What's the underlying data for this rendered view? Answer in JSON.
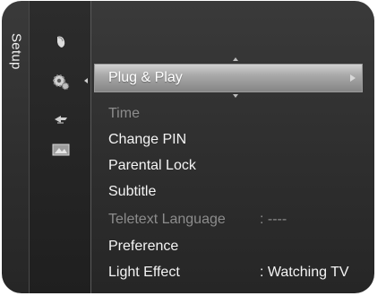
{
  "menu": {
    "category_label": "Setup",
    "icons": [
      "picture-icon",
      "setup-gear-icon",
      "input-icon",
      "application-icon"
    ],
    "highlighted": {
      "label": "Plug & Play"
    },
    "items": [
      {
        "label": "Time",
        "enabled": false
      },
      {
        "label": "Change PIN",
        "enabled": true
      },
      {
        "label": "Parental Lock",
        "enabled": true
      },
      {
        "label": "Subtitle",
        "enabled": true
      },
      {
        "label": "Teletext Language",
        "value": ": ----",
        "enabled": false
      },
      {
        "label": "Preference",
        "enabled": true
      },
      {
        "label": "Light Effect",
        "value": ": Watching TV",
        "enabled": true
      }
    ]
  },
  "colors": {
    "background": "#303030",
    "highlight": "#a9a9a9",
    "text": "#f4f4f4",
    "disabled_text": "#8c8c8c"
  }
}
